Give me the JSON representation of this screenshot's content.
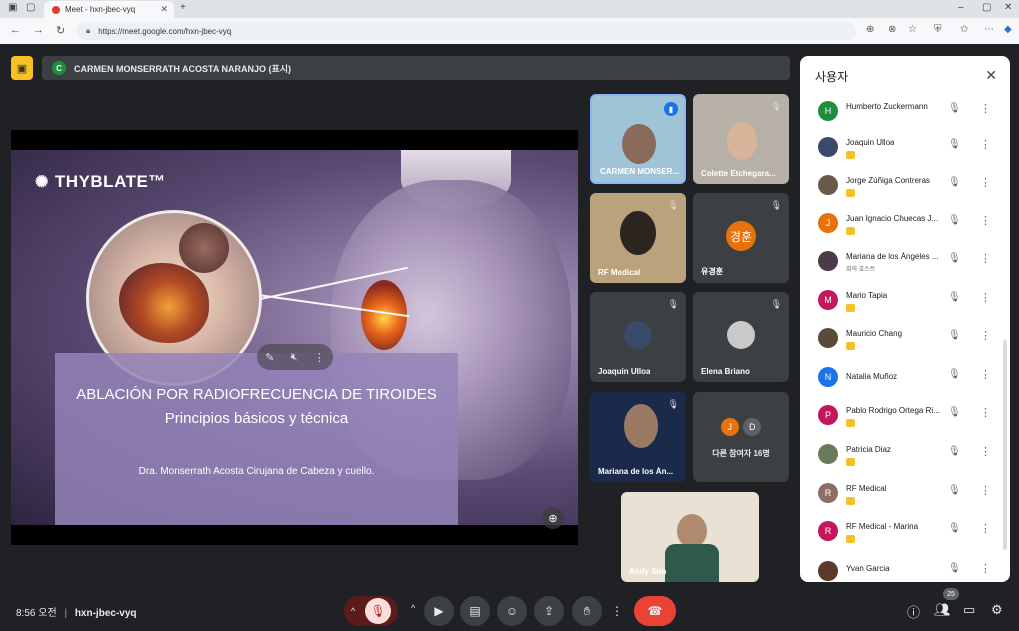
{
  "browser": {
    "tab_title": "Meet - hxn-jbec-vyq",
    "url": "https://meet.google.com/hxn-jbec-vyq"
  },
  "presenter_bar": {
    "avatar_letter": "C",
    "text": "CARMEN MONSERRATH ACOSTA NARANJO (표시)"
  },
  "slide": {
    "logo": "THYBLATE™",
    "title1": "ABLACIÓN POR RADIOFRECUENCIA DE TIROIDES",
    "title2": "Principios básicos y técnica",
    "author": "Dra. Monserrath Acosta Cirujana de Cabeza y cuello."
  },
  "tiles": [
    {
      "name": "CARMEN MONSER...",
      "speaking": true
    },
    {
      "name": "Colette Etchegara..."
    },
    {
      "name": "RF Medical"
    },
    {
      "name": "유경훈",
      "avatar_letter": "경훈"
    },
    {
      "name": "Joaquin Ulloa"
    },
    {
      "name": "Elena Briano"
    },
    {
      "name": "Mariana de los Án..."
    },
    {
      "name": "다른 참여자 16명",
      "letters": [
        "J",
        "D"
      ]
    },
    {
      "name": "Andy Son"
    }
  ],
  "panel": {
    "title": "사용자",
    "people": [
      {
        "name": "Humberto Zuckermann",
        "letter": "H",
        "color": "#1e8e3e",
        "badge": false
      },
      {
        "name": "Joaquin Ulloa",
        "letter": "",
        "color": "#3a4a6a",
        "badge": true
      },
      {
        "name": "Jorge Zúñiga Contreras",
        "letter": "",
        "color": "#6a5a4a",
        "badge": true
      },
      {
        "name": "Juan Ignacio Chuecas J...",
        "letter": "J",
        "color": "#e8710a",
        "badge": true
      },
      {
        "name": "Mariana de los Ángeles ...",
        "letter": "",
        "color": "#4a3a4a",
        "badge": false,
        "sub": "회의 호스트"
      },
      {
        "name": "Mario Tapia",
        "letter": "M",
        "color": "#c2185b",
        "badge": true
      },
      {
        "name": "Mauricio Chang",
        "letter": "",
        "color": "#5a4a3a",
        "badge": true
      },
      {
        "name": "Natalia Muñoz",
        "letter": "N",
        "color": "#1a73e8",
        "badge": false
      },
      {
        "name": "Pablo Rodrigo Ortega Ri...",
        "letter": "P",
        "color": "#c2185b",
        "badge": true
      },
      {
        "name": "Patricia Diaz",
        "letter": "",
        "color": "#6a7a5a",
        "badge": true
      },
      {
        "name": "RF Medical",
        "letter": "R",
        "color": "#8d6e63",
        "badge": true
      },
      {
        "name": "RF Medical - Marina",
        "letter": "R",
        "color": "#c2185b",
        "badge": true
      },
      {
        "name": "Yvan Garcia",
        "letter": "",
        "color": "#5a3a2a",
        "badge": false
      }
    ]
  },
  "bottom": {
    "time": "8:56 오전",
    "meeting_code": "hxn-jbec-vyq",
    "participants_count": "25"
  },
  "colors": {
    "accent": "#1a73e8",
    "end_call": "#ea4335",
    "presenting": "#f6c026"
  }
}
